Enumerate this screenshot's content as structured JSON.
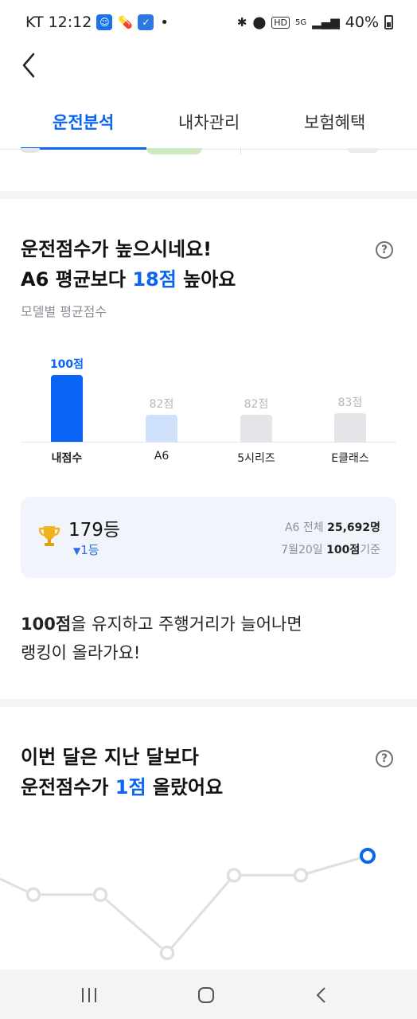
{
  "status_bar": {
    "carrier": "KT",
    "time": "12:12",
    "network": "5G",
    "battery": "40%"
  },
  "tabs": [
    {
      "label": "운전분석",
      "active": true
    },
    {
      "label": "내차관리",
      "active": false
    },
    {
      "label": "보험혜택",
      "active": false
    }
  ],
  "score_section": {
    "title_line1": "운전점수가 높으시네요!",
    "title_line2_prefix": "A6 평균보다 ",
    "title_line2_highlight": "18점",
    "title_line2_suffix": " 높아요",
    "subtitle": "모델별 평균점수",
    "chart_data": {
      "type": "bar",
      "categories": [
        "내점수",
        "A6",
        "5시리즈",
        "E클래스"
      ],
      "values": [
        100,
        82,
        82,
        83
      ],
      "value_labels": [
        "100점",
        "82점",
        "82점",
        "83점"
      ],
      "colors": [
        "#0a64f5",
        "#cfe0fb",
        "#e4e5e8",
        "#e4e5e8"
      ],
      "value_label_colors": [
        "#0a64f5",
        "#b3b7bd",
        "#b3b7bd",
        "#b3b7bd"
      ]
    }
  },
  "ranking": {
    "rank": "179등",
    "change": "1등",
    "total_prefix": "A6 전체 ",
    "total_count": "25,692명",
    "date_prefix": "7월20일 ",
    "date_score": "100점",
    "date_suffix": "기준"
  },
  "message": {
    "highlight": "100점",
    "line1_suffix": "을 유지하고 주행거리가 늘어나면",
    "line2": "랭킹이 올라가요!"
  },
  "monthly_section": {
    "title_line1": "이번 달은 지난 달보다",
    "title_line2_prefix": "운전점수가 ",
    "title_line2_highlight": "1점",
    "title_line2_suffix": " 올랐어요",
    "chart_data": {
      "type": "line",
      "x": [
        1,
        2,
        3,
        4,
        5,
        6
      ],
      "values": [
        96,
        96,
        93,
        97,
        97,
        98
      ],
      "highlight_last": true,
      "line_color": "#dedfe2",
      "highlight_color": "#0a64f5"
    }
  }
}
